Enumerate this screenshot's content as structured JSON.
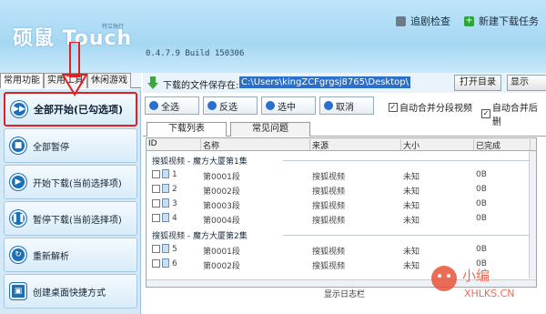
{
  "header": {
    "logo": "硕鼠 Touch",
    "logo_tag": "特立独行",
    "version": "0.4.7.9  Build 150306",
    "links": [
      "追剧检查",
      "新建下载任务"
    ]
  },
  "left_tabs": [
    "常用功能",
    "实用工具",
    "休闲游戏"
  ],
  "sidebar": {
    "buttons": [
      "全部开始(已勾选项)",
      "全部暂停",
      "开始下载(当前选择项)",
      "暂停下载(当前选择项)",
      "重新解析",
      "创建桌面快捷方式"
    ]
  },
  "pathbar": {
    "label": "下载的文件保存在:",
    "path": "C:\\Users\\kingZCFgrgsj8765\\Desktop\\",
    "open_dir": "打开目录",
    "dir_btn": "显示"
  },
  "toolbar": {
    "select_all": "全选",
    "invert": "反选",
    "select": "选中",
    "cancel": "取消",
    "auto_merge": "自动合并分段视频",
    "auto_merge_delete": "自动合并后删"
  },
  "content_tabs": [
    "下载列表",
    "常见问题"
  ],
  "table": {
    "headers": [
      "ID",
      "名称",
      "来源",
      "大小",
      "已完成"
    ],
    "groups": [
      {
        "title": "搜狐视频 - 魔方大厦第1集",
        "rows": [
          {
            "id": "1",
            "name": "第0001段",
            "source": "搜狐视频",
            "size": "未知",
            "done": "0B"
          },
          {
            "id": "2",
            "name": "第0002段",
            "source": "搜狐视频",
            "size": "未知",
            "done": "0B"
          },
          {
            "id": "3",
            "name": "第0003段",
            "source": "搜狐视频",
            "size": "未知",
            "done": "0B"
          },
          {
            "id": "4",
            "name": "第0004段",
            "source": "搜狐视频",
            "size": "未知",
            "done": "0B"
          }
        ]
      },
      {
        "title": "搜狐视频 - 魔方大厦第2集",
        "rows": [
          {
            "id": "5",
            "name": "第0001段",
            "source": "搜狐视频",
            "size": "未知",
            "done": "0B"
          },
          {
            "id": "6",
            "name": "第0002段",
            "source": "搜狐视频",
            "size": "未知",
            "done": "0B"
          }
        ]
      }
    ]
  },
  "status": "显示日志栏",
  "watermark": {
    "cn": "小编",
    "en": "XHLKS.CN"
  },
  "colors": {
    "header_bg": "#a6d7f3",
    "accent": "#1f6fb3",
    "highlight": "#e02020",
    "selected_path_bg": "#2a6fc9"
  }
}
